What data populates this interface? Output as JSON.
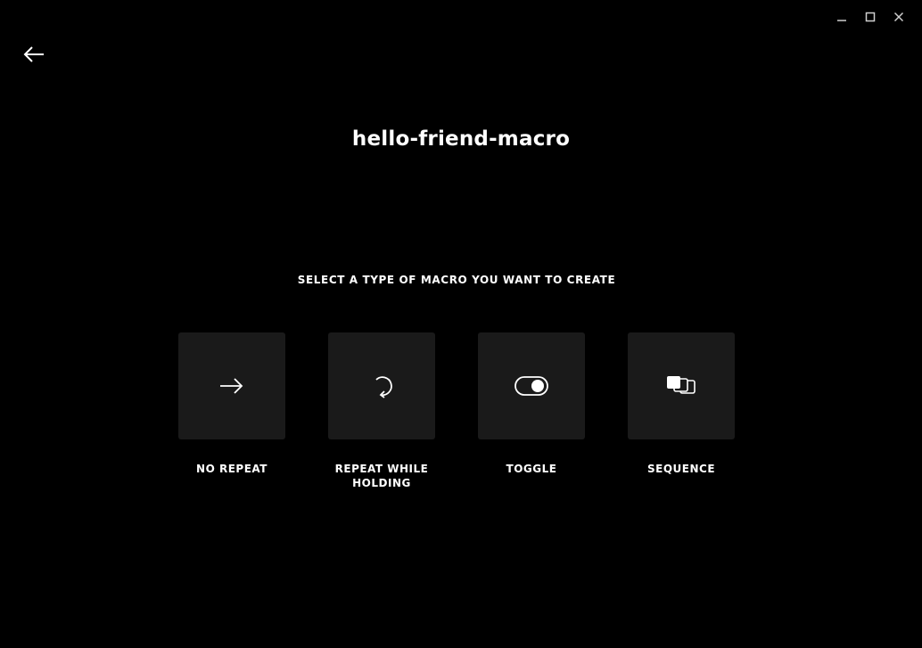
{
  "window": {
    "controls": [
      {
        "name": "minimize-icon"
      },
      {
        "name": "maximize-icon"
      },
      {
        "name": "close-icon"
      }
    ]
  },
  "header": {
    "back_icon": "arrow-left-icon",
    "title": "hello-friend-macro"
  },
  "main": {
    "prompt": "SELECT A TYPE OF MACRO YOU WANT TO CREATE",
    "options": [
      {
        "label": "NO REPEAT",
        "icon": "arrow-right-icon"
      },
      {
        "label": "REPEAT WHILE HOLDING",
        "icon": "repeat-icon"
      },
      {
        "label": "TOGGLE",
        "icon": "toggle-icon"
      },
      {
        "label": "SEQUENCE",
        "icon": "sequence-icon"
      }
    ]
  },
  "colors": {
    "background": "#000000",
    "tile": "#1a1a1a",
    "text": "#ffffff"
  }
}
